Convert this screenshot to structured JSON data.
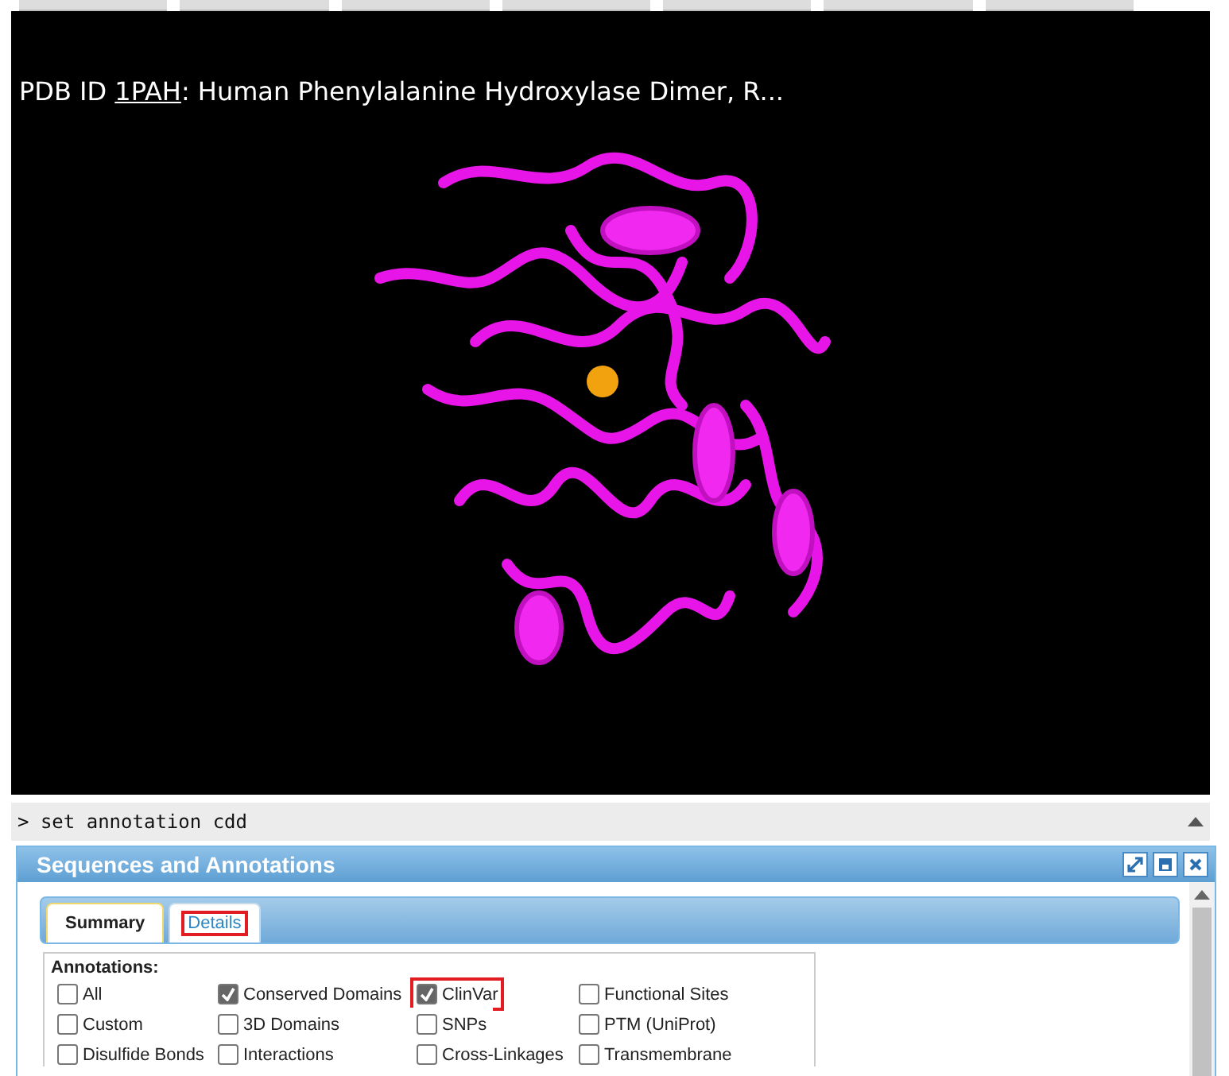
{
  "viewer": {
    "title_prefix": "PDB ID ",
    "pdb_id": "1PAH",
    "title_rest": ": Human Phenylalanine Hydroxylase Dimer, R..."
  },
  "console": {
    "lines": [
      "> set annotation cdd"
    ]
  },
  "dialog": {
    "title": "Sequences and Annotations",
    "tabs": [
      {
        "label": "Summary",
        "selected": true,
        "highlighted": false
      },
      {
        "label": "Details",
        "selected": false,
        "highlighted": true
      }
    ],
    "annotations": {
      "legend": "Annotations:",
      "columns": [
        [
          {
            "label": "All",
            "checked": false,
            "highlighted": false
          },
          {
            "label": "Custom",
            "checked": false,
            "highlighted": false
          },
          {
            "label": "Disulfide Bonds",
            "checked": false,
            "highlighted": false
          }
        ],
        [
          {
            "label": "Conserved Domains",
            "checked": true,
            "highlighted": false
          },
          {
            "label": "3D Domains",
            "checked": false,
            "highlighted": false
          },
          {
            "label": "Interactions",
            "checked": false,
            "highlighted": false
          }
        ],
        [
          {
            "label": "ClinVar",
            "checked": true,
            "highlighted": true
          },
          {
            "label": "SNPs",
            "checked": false,
            "highlighted": false
          },
          {
            "label": "Cross-Linkages",
            "checked": false,
            "highlighted": false
          }
        ],
        [
          {
            "label": "Functional Sites",
            "checked": false,
            "highlighted": false
          },
          {
            "label": "PTM (UniProt)",
            "checked": false,
            "highlighted": false
          },
          {
            "label": "Transmembrane",
            "checked": false,
            "highlighted": false
          }
        ]
      ]
    }
  }
}
